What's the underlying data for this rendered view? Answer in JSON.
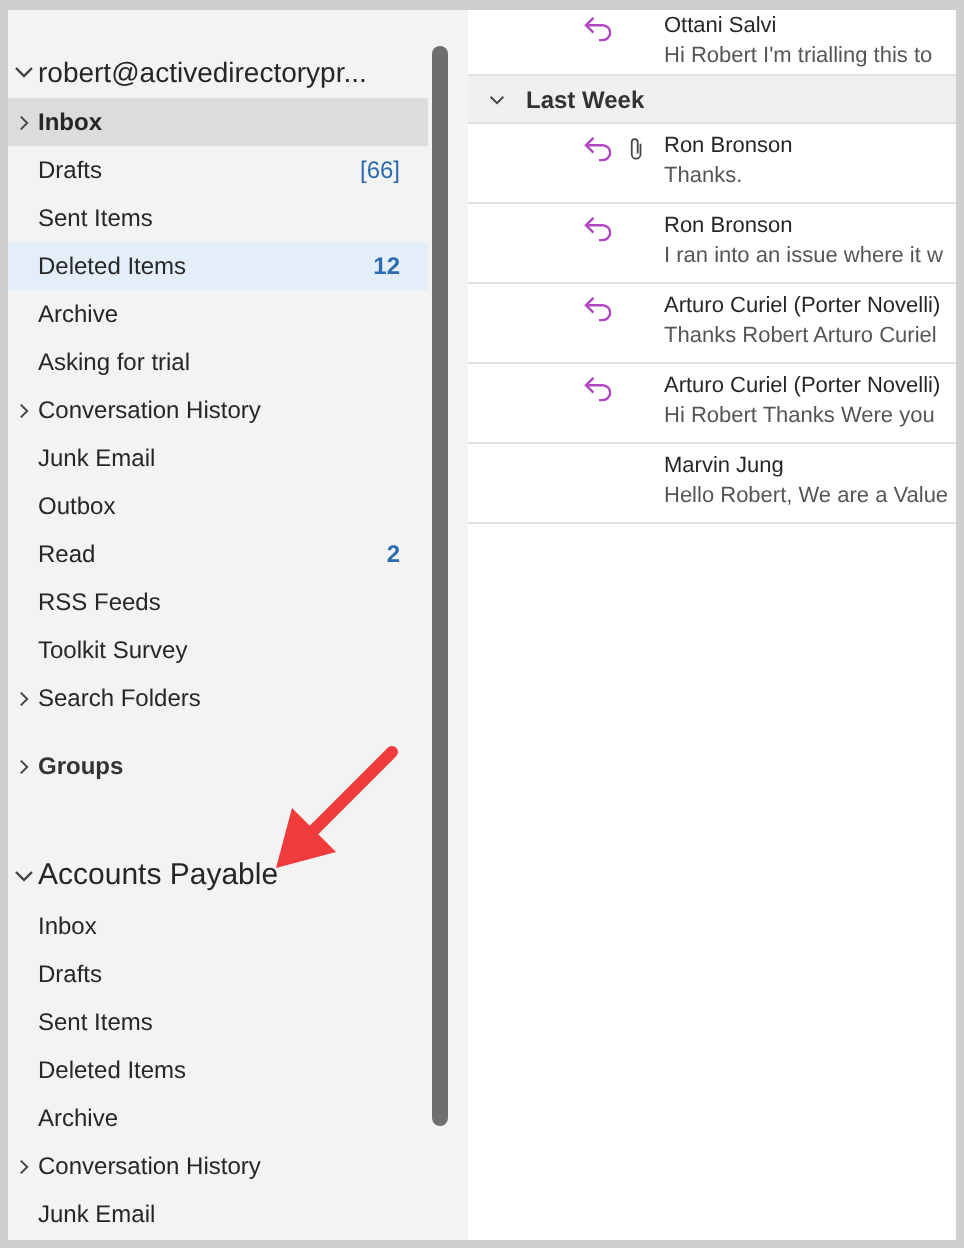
{
  "folder_pane": {
    "accounts": [
      {
        "name": "robert@activedirectorypr...",
        "expanded": true,
        "folders": [
          {
            "label": "Inbox",
            "has_children": true,
            "selected": true,
            "hovered": false,
            "bold": true
          },
          {
            "label": "Drafts",
            "has_children": false,
            "selected": false,
            "hovered": false,
            "bold": false,
            "count": "[66]",
            "count_bold": false
          },
          {
            "label": "Sent Items",
            "has_children": false,
            "selected": false,
            "hovered": false,
            "bold": false
          },
          {
            "label": "Deleted Items",
            "has_children": false,
            "selected": false,
            "hovered": true,
            "bold": false,
            "count": "12",
            "count_bold": true
          },
          {
            "label": "Archive",
            "has_children": false,
            "selected": false,
            "hovered": false,
            "bold": false
          },
          {
            "label": "Asking for trial",
            "has_children": false,
            "selected": false,
            "hovered": false,
            "bold": false
          },
          {
            "label": "Conversation History",
            "has_children": true,
            "selected": false,
            "hovered": false,
            "bold": false
          },
          {
            "label": "Junk Email",
            "has_children": false,
            "selected": false,
            "hovered": false,
            "bold": false
          },
          {
            "label": "Outbox",
            "has_children": false,
            "selected": false,
            "hovered": false,
            "bold": false
          },
          {
            "label": "Read",
            "has_children": false,
            "selected": false,
            "hovered": false,
            "bold": false,
            "count": "2",
            "count_bold": true
          },
          {
            "label": "RSS Feeds",
            "has_children": false,
            "selected": false,
            "hovered": false,
            "bold": false
          },
          {
            "label": "Toolkit Survey",
            "has_children": false,
            "selected": false,
            "hovered": false,
            "bold": false
          },
          {
            "label": "Search Folders",
            "has_children": true,
            "selected": false,
            "hovered": false,
            "bold": false
          }
        ],
        "groups": {
          "label": "Groups",
          "expanded": false
        }
      },
      {
        "name": "Accounts Payable",
        "expanded": true,
        "folders": [
          {
            "label": "Inbox",
            "has_children": false,
            "selected": false,
            "hovered": false,
            "bold": false
          },
          {
            "label": "Drafts",
            "has_children": false,
            "selected": false,
            "hovered": false,
            "bold": false
          },
          {
            "label": "Sent Items",
            "has_children": false,
            "selected": false,
            "hovered": false,
            "bold": false
          },
          {
            "label": "Deleted Items",
            "has_children": false,
            "selected": false,
            "hovered": false,
            "bold": false
          },
          {
            "label": "Archive",
            "has_children": false,
            "selected": false,
            "hovered": false,
            "bold": false
          },
          {
            "label": "Conversation History",
            "has_children": true,
            "selected": false,
            "hovered": false,
            "bold": false
          },
          {
            "label": "Junk Email",
            "has_children": false,
            "selected": false,
            "hovered": false,
            "bold": false
          }
        ]
      }
    ]
  },
  "message_list": {
    "top_message": {
      "sender": "Ottani Salvi",
      "preview": "Hi Robert  I'm trialling this to",
      "replied": true
    },
    "group": {
      "label": "Last Week",
      "expanded": true
    },
    "messages": [
      {
        "sender": "Ron Bronson",
        "preview": "Thanks.",
        "replied": true,
        "attachment": true
      },
      {
        "sender": "Ron Bronson",
        "preview": "I ran into an issue where it w",
        "replied": true,
        "attachment": false
      },
      {
        "sender": "Arturo Curiel (Porter Novelli)",
        "preview": "Thanks Robert  Arturo Curiel",
        "replied": true,
        "attachment": false
      },
      {
        "sender": "Arturo Curiel (Porter Novelli)",
        "preview": "Hi Robert  Thanks  Were you",
        "replied": true,
        "attachment": false
      },
      {
        "sender": "Marvin Jung",
        "preview": "Hello Robert,  We are a Value",
        "replied": false,
        "attachment": false
      }
    ]
  },
  "annotation": {
    "kind": "arrow"
  }
}
